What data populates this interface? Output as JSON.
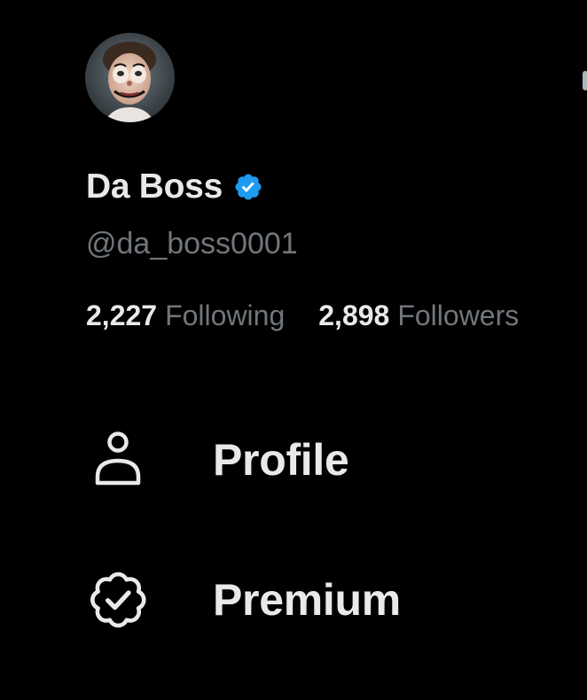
{
  "theme": {
    "background": "#000000",
    "primary_text": "#e7e9ea",
    "secondary_text": "#71767b",
    "verified_blue": "#1d9bf0"
  },
  "profile": {
    "avatar_icon": "clown-face-avatar",
    "display_name": "Da Boss",
    "verified_icon": "verified-badge-icon",
    "handle": "@da_boss0001",
    "following_count": "2,227",
    "following_label": "Following",
    "followers_count": "2,898",
    "followers_label": "Followers"
  },
  "menu": {
    "items": [
      {
        "icon": "person-icon",
        "label": "Profile"
      },
      {
        "icon": "premium-badge-icon",
        "label": "Premium"
      }
    ]
  }
}
